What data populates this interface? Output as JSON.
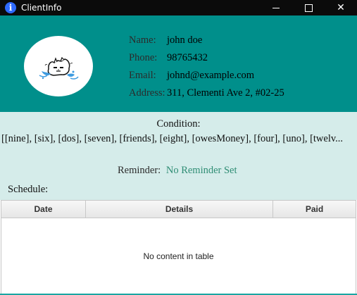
{
  "window": {
    "title": "ClientInfo"
  },
  "client": {
    "name_label": "Name:",
    "name": "john doe",
    "phone_label": "Phone:",
    "phone": "98765432",
    "email_label": "Email:",
    "email": "johnd@example.com",
    "address_label": "Address:",
    "address": "311, Clementi Ave 2, #02-25"
  },
  "conditions": {
    "heading": "Condition:",
    "tags_text": "[[nine], [six], [dos], [seven], [friends], [eight], [owesMoney], [four], [uno], [twelv..."
  },
  "reminder": {
    "label": "Reminder:",
    "value": "No Reminder Set"
  },
  "schedule": {
    "label": "Schedule:",
    "columns": [
      "Date",
      "Details",
      "Paid"
    ],
    "placeholder": "No content in table"
  },
  "colors": {
    "header_bg": "#008f8b",
    "body_bg": "#d5ecea",
    "reminder_value": "#2f8d74",
    "titlebar_bg": "#0b0b0b"
  },
  "icons": {
    "app": "info-icon",
    "avatar": "cartoon-avatar"
  }
}
